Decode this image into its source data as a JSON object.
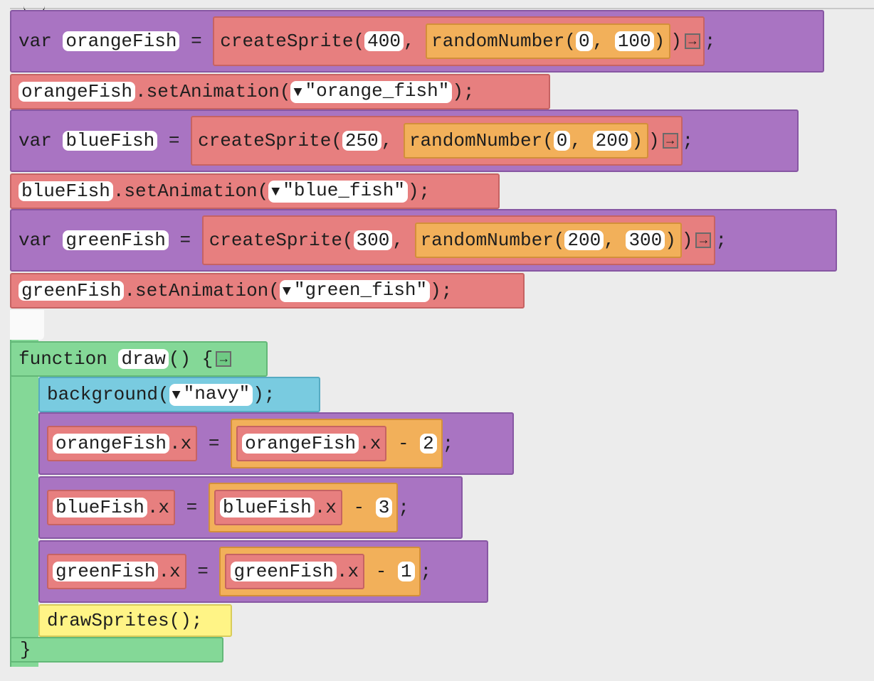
{
  "colors": {
    "var_block": "#a974c2",
    "sprite_block": "#e77f7f",
    "math_block": "#f2b05a",
    "function_block": "#84d897",
    "world_block": "#79cbe0",
    "draw_block": "#fff486"
  },
  "icons": {
    "expand": "→",
    "dropdown": "▼"
  },
  "kw": {
    "var": "var",
    "eq": "=",
    "semi": ";",
    "comma": ",",
    "lparen": "(",
    "rparen": ")",
    "rparen_semi": ");",
    "minus": "-",
    "dotx": ".x",
    "func": "function",
    "parens_brace": "() {",
    "close_brace": "}"
  },
  "lines": {
    "orange_var": {
      "name": "orangeFish",
      "call": "createSprite",
      "x": "400",
      "rand": "randomNumber",
      "min": "0",
      "max": "100"
    },
    "orange_anim": {
      "target": "orangeFish",
      "method": ".setAnimation",
      "arg": "\"orange_fish\""
    },
    "blue_var": {
      "name": "blueFish",
      "call": "createSprite",
      "x": "250",
      "rand": "randomNumber",
      "min": "0",
      "max": "200"
    },
    "blue_anim": {
      "target": "blueFish",
      "method": ".setAnimation",
      "arg": "\"blue_fish\""
    },
    "green_var": {
      "name": "greenFish",
      "call": "createSprite",
      "x": "300",
      "rand": "randomNumber",
      "min": "200",
      "max": "300"
    },
    "green_anim": {
      "target": "greenFish",
      "method": ".setAnimation",
      "arg": "\"green_fish\""
    }
  },
  "draw_fn": {
    "name": "draw",
    "background": {
      "call": "background",
      "arg": "\"navy\""
    },
    "moves": [
      {
        "target": "orangeFish",
        "source": "orangeFish",
        "amount": "2"
      },
      {
        "target": "blueFish",
        "source": "blueFish",
        "amount": "3"
      },
      {
        "target": "greenFish",
        "source": "greenFish",
        "amount": "1"
      }
    ],
    "draw_sprites": "drawSprites();"
  }
}
